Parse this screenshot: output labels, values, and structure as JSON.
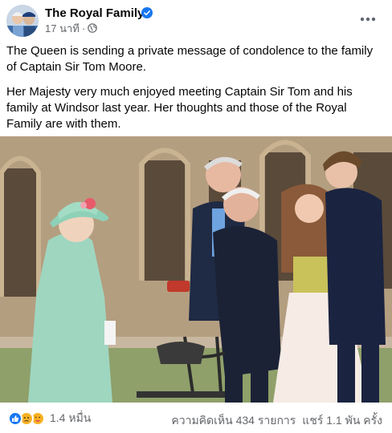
{
  "post": {
    "page_name": "The Royal Family",
    "time_label": "17 นาที",
    "separator": "·",
    "paragraphs": [
      "The Queen is sending a private message of condolence to the family of Captain Sir Tom Moore.",
      "Her Majesty very much enjoyed meeting Captain Sir Tom and his family at Windsor last year. Her thoughts and those of the Royal Family are with them."
    ]
  },
  "footer": {
    "reaction_count": "1.4 หมื่น",
    "comments": "ความคิดเห็น 434 รายการ",
    "shares": "แชร์ 1.1 พัน ครั้ง"
  },
  "icons": {
    "verified": "verified-badge-icon",
    "privacy": "globe-icon",
    "more": "more-options-icon",
    "reactions": [
      "like-reaction-icon",
      "sad-reaction-icon",
      "care-reaction-icon"
    ]
  },
  "colors": {
    "brand": "#1877f2",
    "secondary_text": "#65676b",
    "like": "#1877f2",
    "sad": "#f7b125"
  }
}
